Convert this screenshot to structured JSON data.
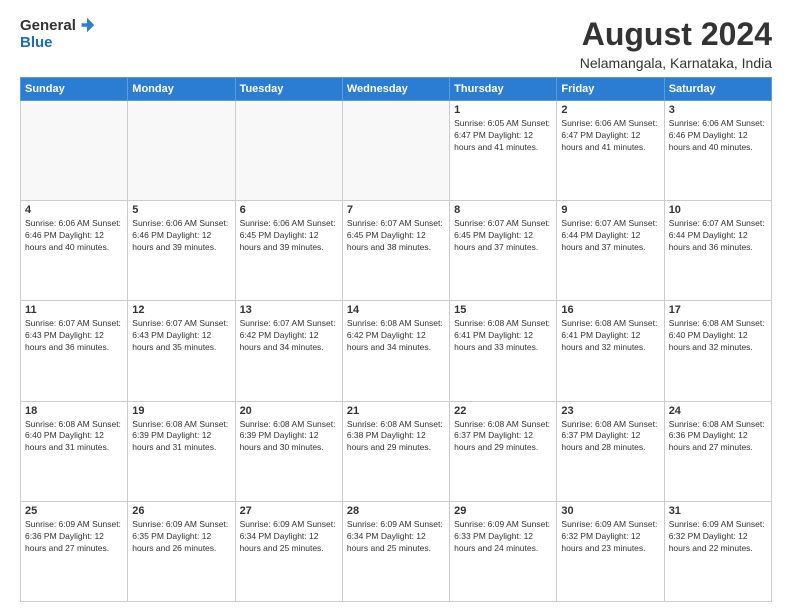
{
  "header": {
    "logo_general": "General",
    "logo_blue": "Blue",
    "main_title": "August 2024",
    "sub_title": "Nelamangala, Karnataka, India"
  },
  "weekdays": [
    "Sunday",
    "Monday",
    "Tuesday",
    "Wednesday",
    "Thursday",
    "Friday",
    "Saturday"
  ],
  "weeks": [
    [
      {
        "day": "",
        "info": ""
      },
      {
        "day": "",
        "info": ""
      },
      {
        "day": "",
        "info": ""
      },
      {
        "day": "",
        "info": ""
      },
      {
        "day": "1",
        "info": "Sunrise: 6:05 AM\nSunset: 6:47 PM\nDaylight: 12 hours\nand 41 minutes."
      },
      {
        "day": "2",
        "info": "Sunrise: 6:06 AM\nSunset: 6:47 PM\nDaylight: 12 hours\nand 41 minutes."
      },
      {
        "day": "3",
        "info": "Sunrise: 6:06 AM\nSunset: 6:46 PM\nDaylight: 12 hours\nand 40 minutes."
      }
    ],
    [
      {
        "day": "4",
        "info": "Sunrise: 6:06 AM\nSunset: 6:46 PM\nDaylight: 12 hours\nand 40 minutes."
      },
      {
        "day": "5",
        "info": "Sunrise: 6:06 AM\nSunset: 6:46 PM\nDaylight: 12 hours\nand 39 minutes."
      },
      {
        "day": "6",
        "info": "Sunrise: 6:06 AM\nSunset: 6:45 PM\nDaylight: 12 hours\nand 39 minutes."
      },
      {
        "day": "7",
        "info": "Sunrise: 6:07 AM\nSunset: 6:45 PM\nDaylight: 12 hours\nand 38 minutes."
      },
      {
        "day": "8",
        "info": "Sunrise: 6:07 AM\nSunset: 6:45 PM\nDaylight: 12 hours\nand 37 minutes."
      },
      {
        "day": "9",
        "info": "Sunrise: 6:07 AM\nSunset: 6:44 PM\nDaylight: 12 hours\nand 37 minutes."
      },
      {
        "day": "10",
        "info": "Sunrise: 6:07 AM\nSunset: 6:44 PM\nDaylight: 12 hours\nand 36 minutes."
      }
    ],
    [
      {
        "day": "11",
        "info": "Sunrise: 6:07 AM\nSunset: 6:43 PM\nDaylight: 12 hours\nand 36 minutes."
      },
      {
        "day": "12",
        "info": "Sunrise: 6:07 AM\nSunset: 6:43 PM\nDaylight: 12 hours\nand 35 minutes."
      },
      {
        "day": "13",
        "info": "Sunrise: 6:07 AM\nSunset: 6:42 PM\nDaylight: 12 hours\nand 34 minutes."
      },
      {
        "day": "14",
        "info": "Sunrise: 6:08 AM\nSunset: 6:42 PM\nDaylight: 12 hours\nand 34 minutes."
      },
      {
        "day": "15",
        "info": "Sunrise: 6:08 AM\nSunset: 6:41 PM\nDaylight: 12 hours\nand 33 minutes."
      },
      {
        "day": "16",
        "info": "Sunrise: 6:08 AM\nSunset: 6:41 PM\nDaylight: 12 hours\nand 32 minutes."
      },
      {
        "day": "17",
        "info": "Sunrise: 6:08 AM\nSunset: 6:40 PM\nDaylight: 12 hours\nand 32 minutes."
      }
    ],
    [
      {
        "day": "18",
        "info": "Sunrise: 6:08 AM\nSunset: 6:40 PM\nDaylight: 12 hours\nand 31 minutes."
      },
      {
        "day": "19",
        "info": "Sunrise: 6:08 AM\nSunset: 6:39 PM\nDaylight: 12 hours\nand 31 minutes."
      },
      {
        "day": "20",
        "info": "Sunrise: 6:08 AM\nSunset: 6:39 PM\nDaylight: 12 hours\nand 30 minutes."
      },
      {
        "day": "21",
        "info": "Sunrise: 6:08 AM\nSunset: 6:38 PM\nDaylight: 12 hours\nand 29 minutes."
      },
      {
        "day": "22",
        "info": "Sunrise: 6:08 AM\nSunset: 6:37 PM\nDaylight: 12 hours\nand 29 minutes."
      },
      {
        "day": "23",
        "info": "Sunrise: 6:08 AM\nSunset: 6:37 PM\nDaylight: 12 hours\nand 28 minutes."
      },
      {
        "day": "24",
        "info": "Sunrise: 6:08 AM\nSunset: 6:36 PM\nDaylight: 12 hours\nand 27 minutes."
      }
    ],
    [
      {
        "day": "25",
        "info": "Sunrise: 6:09 AM\nSunset: 6:36 PM\nDaylight: 12 hours\nand 27 minutes."
      },
      {
        "day": "26",
        "info": "Sunrise: 6:09 AM\nSunset: 6:35 PM\nDaylight: 12 hours\nand 26 minutes."
      },
      {
        "day": "27",
        "info": "Sunrise: 6:09 AM\nSunset: 6:34 PM\nDaylight: 12 hours\nand 25 minutes."
      },
      {
        "day": "28",
        "info": "Sunrise: 6:09 AM\nSunset: 6:34 PM\nDaylight: 12 hours\nand 25 minutes."
      },
      {
        "day": "29",
        "info": "Sunrise: 6:09 AM\nSunset: 6:33 PM\nDaylight: 12 hours\nand 24 minutes."
      },
      {
        "day": "30",
        "info": "Sunrise: 6:09 AM\nSunset: 6:32 PM\nDaylight: 12 hours\nand 23 minutes."
      },
      {
        "day": "31",
        "info": "Sunrise: 6:09 AM\nSunset: 6:32 PM\nDaylight: 12 hours\nand 22 minutes."
      }
    ]
  ]
}
